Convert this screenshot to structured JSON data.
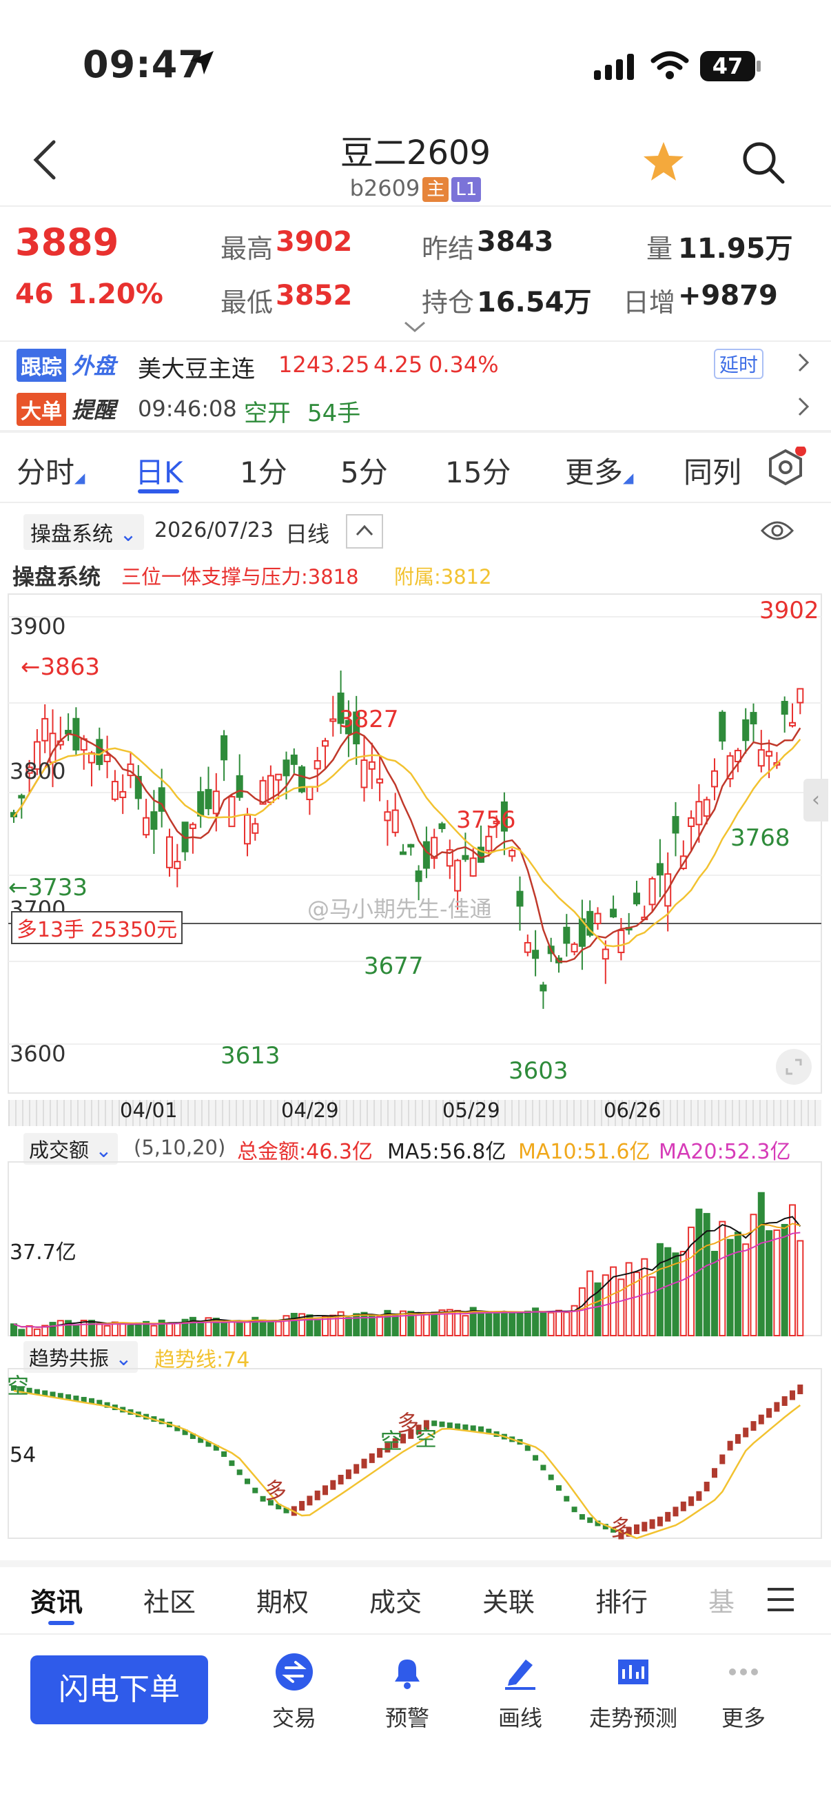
{
  "status": {
    "time": "09:47",
    "battery": "47"
  },
  "header": {
    "title": "豆二2609",
    "code": "b2609",
    "tag_main": "主",
    "tag_level": "L1"
  },
  "quote": {
    "last": "3889",
    "change": "46",
    "change_pct": "1.20%",
    "high_label": "最高",
    "high": "3902",
    "low_label": "最低",
    "low": "3852",
    "prev_settle_label": "昨结",
    "prev_settle": "3843",
    "oi_label": "持仓",
    "oi": "16.54万",
    "volume_label": "量",
    "volume": "11.95万",
    "day_add_label": "日增",
    "day_add": "+9879"
  },
  "follow_row": {
    "badge1": "跟踪",
    "badge2": "外盘",
    "name": "美大豆主连",
    "price": "1243.25",
    "chg": "4.25",
    "pct": "0.34%",
    "delay": "延时"
  },
  "bigorder_row": {
    "badge1": "大单",
    "badge2": "提醒",
    "time": "09:46:08",
    "action": "空开",
    "qty": "54手"
  },
  "period_tabs": [
    {
      "label": "分时"
    },
    {
      "label": "日K"
    },
    {
      "label": "1分"
    },
    {
      "label": "5分"
    },
    {
      "label": "15分"
    },
    {
      "label": "更多"
    },
    {
      "label": "同列"
    }
  ],
  "chart_toolbar": {
    "system": "操盘系统",
    "date": "2026/07/23",
    "period": "日线"
  },
  "indicator_line": {
    "name": "操盘系统",
    "support": "三位一体支撑与压力:3818",
    "attach": "附属:3812"
  },
  "main_chart": {
    "y_labels": [
      "3900",
      "3800",
      "3700",
      "3600"
    ],
    "annotations": {
      "high_3902": "3902",
      "hi_3863": "←3863",
      "hi_3827": "3827",
      "hi_3756": "3756",
      "lo_3733": "←3733",
      "lo_3677": "3677",
      "lo_3613": "3613",
      "lo_3603": "3603",
      "lo_3768": "3768"
    },
    "position_tag": "多13手 25350元",
    "watermark": "@马小期先生-佳通",
    "x_labels": [
      "04/01",
      "04/29",
      "05/29",
      "06/26"
    ]
  },
  "volume_panel": {
    "name": "成交额",
    "params": "(5,10,20)",
    "total": "总金额:46.3亿",
    "ma5": "MA5:56.8亿",
    "ma10": "MA10:51.6亿",
    "ma20": "MA20:52.3亿",
    "y_label": "37.7亿"
  },
  "trend_panel": {
    "name": "趋势共振",
    "trend_line": "趋势线:74",
    "y_label": "54",
    "marks": {
      "kong1": "空",
      "duo1": "多",
      "duo2": "多",
      "kong2": "空",
      "kong3": "空",
      "duo3": "多"
    }
  },
  "bottom_tabs": [
    {
      "label": "资讯"
    },
    {
      "label": "社区"
    },
    {
      "label": "期权"
    },
    {
      "label": "成交"
    },
    {
      "label": "关联"
    },
    {
      "label": "排行"
    },
    {
      "label": "基"
    }
  ],
  "bottom_nav": {
    "primary": "闪电下单",
    "items": [
      {
        "label": "交易"
      },
      {
        "label": "预警"
      },
      {
        "label": "画线"
      },
      {
        "label": "走势预测"
      },
      {
        "label": "更多"
      }
    ]
  },
  "colors": {
    "up": "#e8312f",
    "down": "#2e8b3a",
    "ma_dark": "#c0392b",
    "ma_gold": "#f2c230",
    "accent_blue": "#2f5bea"
  }
}
